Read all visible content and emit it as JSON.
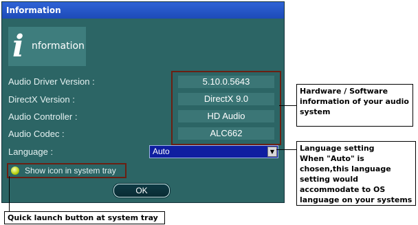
{
  "window": {
    "title": "Information",
    "logo_text": "nformation",
    "logo_letter": "i"
  },
  "info": {
    "rows": [
      {
        "label": "Audio Driver Version :",
        "value": "5.10.0.5643"
      },
      {
        "label": "DirectX Version :",
        "value": "DirectX 9.0"
      },
      {
        "label": "Audio Controller :",
        "value": "HD Audio"
      },
      {
        "label": "Audio Codec :",
        "value": "ALC662"
      }
    ]
  },
  "language": {
    "label": "Language :",
    "selected": "Auto",
    "arrow_glyph": "▼"
  },
  "tray": {
    "label": "Show icon in system tray"
  },
  "ok_label": "OK",
  "callouts": {
    "hardware": "Hardware / Software information of your audio system",
    "language": "Language setting\nWhen \"Auto\" is chosen,this language setting would accommodate to OS language on your systems",
    "quick_launch": "Quick launch button at system tray"
  },
  "colors": {
    "window_bg": "#2c6565",
    "titlebar": "#2f63d6",
    "highlight_border": "#6b1f12",
    "dropdown_bg": "#0f1ea0"
  }
}
